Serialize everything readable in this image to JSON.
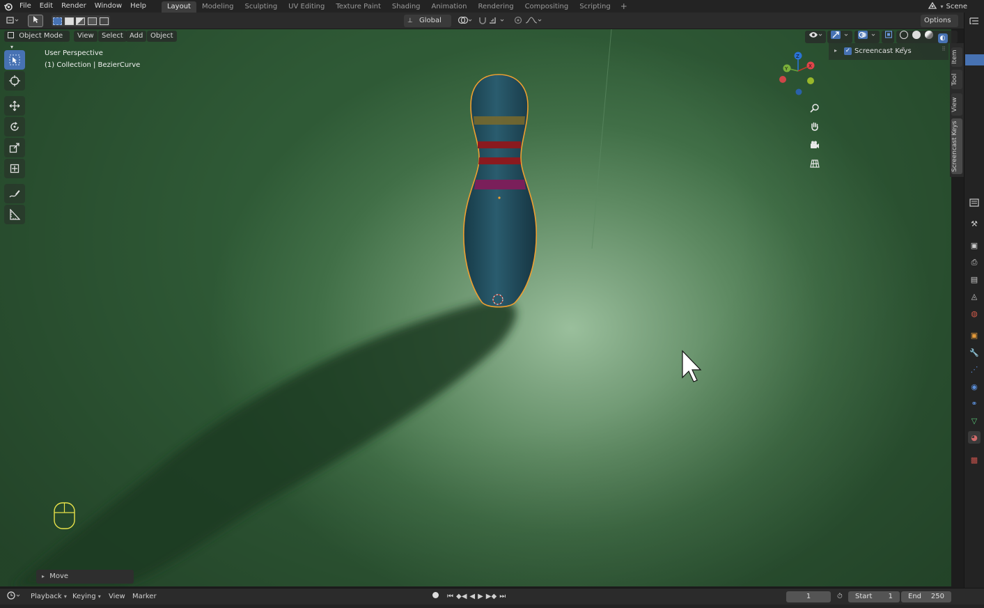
{
  "topbar": {
    "menus": [
      "File",
      "Edit",
      "Render",
      "Window",
      "Help"
    ],
    "workspaces": [
      "Layout",
      "Modeling",
      "Sculpting",
      "UV Editing",
      "Texture Paint",
      "Shading",
      "Animation",
      "Rendering",
      "Compositing",
      "Scripting"
    ],
    "active_workspace": "Layout",
    "add_tab": "+",
    "scene_label": "Scene"
  },
  "toolheader": {
    "transform_orientation": "Global",
    "options_label": "Options"
  },
  "viewport_header": {
    "mode": "Object Mode",
    "menus": [
      "View",
      "Select",
      "Add",
      "Object"
    ]
  },
  "viewport": {
    "perspective_label": "User Perspective",
    "collection_label": "(1) Collection | BezierCurve",
    "gizmo_axes": [
      "X",
      "Y",
      "Z"
    ]
  },
  "npanel": {
    "addon_label": "Screencast Keys",
    "addon_enabled": true,
    "tabs": [
      "Item",
      "Tool",
      "View",
      "Screencast Keys"
    ]
  },
  "operator_panel": {
    "label": "Move"
  },
  "timeline": {
    "menus": [
      "Playback",
      "Keying",
      "View",
      "Marker"
    ],
    "current_frame": "1",
    "start_label": "Start",
    "start_value": "1",
    "end_label": "End",
    "end_value": "250"
  },
  "colors": {
    "accent": "#4772b3",
    "selection_outline": "#f0a030",
    "pin_body": "#1f4a5a"
  }
}
